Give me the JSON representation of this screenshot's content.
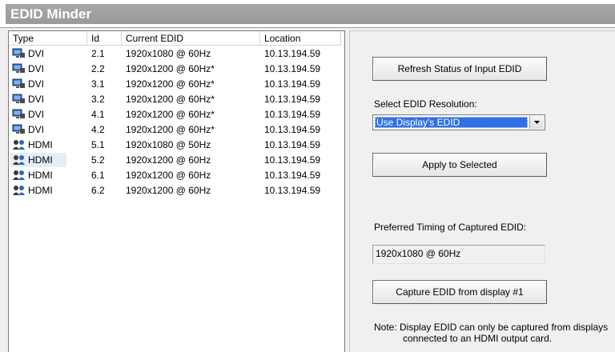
{
  "app": {
    "title": "EDID Minder"
  },
  "table": {
    "columns": [
      "Type",
      "Id",
      "Current EDID",
      "Location"
    ],
    "rows": [
      {
        "icon": "dvi-monitor-icon",
        "type": "DVI",
        "id": "2.1",
        "edid": "1920x1080 @ 60Hz",
        "location": "10.13.194.59"
      },
      {
        "icon": "dvi-monitor-icon",
        "type": "DVI",
        "id": "2.2",
        "edid": "1920x1200 @ 60Hz*",
        "location": "10.13.194.59"
      },
      {
        "icon": "dvi-monitor-icon",
        "type": "DVI",
        "id": "3.1",
        "edid": "1920x1200 @ 60Hz*",
        "location": "10.13.194.59"
      },
      {
        "icon": "dvi-monitor-icon",
        "type": "DVI",
        "id": "3.2",
        "edid": "1920x1200 @ 60Hz*",
        "location": "10.13.194.59"
      },
      {
        "icon": "dvi-monitor-icon",
        "type": "DVI",
        "id": "4.1",
        "edid": "1920x1200 @ 60Hz*",
        "location": "10.13.194.59"
      },
      {
        "icon": "dvi-monitor-icon",
        "type": "DVI",
        "id": "4.2",
        "edid": "1920x1200 @ 60Hz*",
        "location": "10.13.194.59"
      },
      {
        "icon": "hdmi-users-icon",
        "type": "HDMI",
        "id": "5.1",
        "edid": "1920x1080 @ 50Hz",
        "location": "10.13.194.59"
      },
      {
        "icon": "hdmi-users-icon",
        "type": "HDMI",
        "id": "5.2",
        "edid": "1920x1200 @ 60Hz",
        "location": "10.13.194.59",
        "highlighted": true
      },
      {
        "icon": "hdmi-users-icon",
        "type": "HDMI",
        "id": "6.1",
        "edid": "1920x1200 @ 60Hz",
        "location": "10.13.194.59"
      },
      {
        "icon": "hdmi-users-icon",
        "type": "HDMI",
        "id": "6.2",
        "edid": "1920x1200 @ 60Hz",
        "location": "10.13.194.59"
      }
    ]
  },
  "controls": {
    "refresh_label": "Refresh Status of Input EDID",
    "select_label": "Select EDID Resolution:",
    "select_value": "Use Display's EDID",
    "apply_label": "Apply to Selected",
    "preferred_label": "Preferred Timing of Captured EDID:",
    "preferred_value": "1920x1080 @ 60Hz",
    "capture_label": "Capture EDID from display #1",
    "note_line1": "Note: Display EDID can only be captured from displays",
    "note_line2": "connected to an HDMI output card."
  },
  "colors": {
    "title_bar": "#a0a0a0",
    "selection": "#3170e3",
    "row_highlight": "#e5edf9"
  }
}
